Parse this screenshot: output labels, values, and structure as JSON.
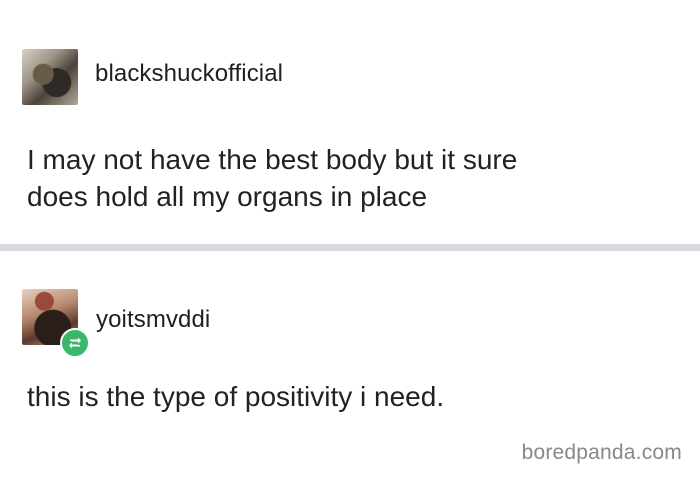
{
  "posts": [
    {
      "username": "blackshuckofficial",
      "text_lines": [
        "I may not have the best body but it sure",
        "does hold all my organs in place"
      ]
    },
    {
      "username": "yoitsmvddi",
      "reblog_badge_icon": "reblog-icon",
      "text": "this is the type of positivity i need."
    }
  ],
  "watermark": "boredpanda.com",
  "colors": {
    "divider": "#d9d9df",
    "reblog_badge": "#39b86b",
    "text": "#222222",
    "watermark": "#888888"
  }
}
